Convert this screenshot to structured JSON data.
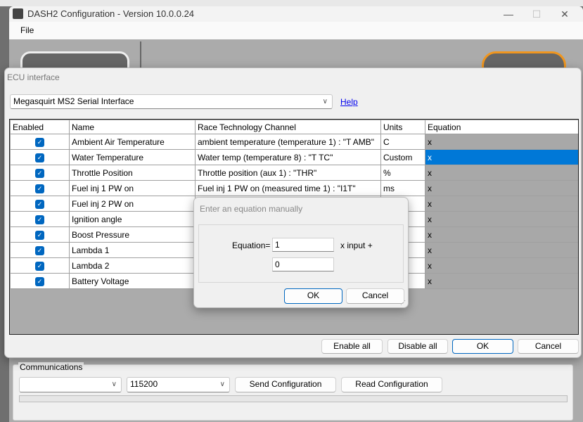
{
  "main_window": {
    "title": "DASH2 Configuration - Version 10.0.0.24",
    "menu": [
      "File"
    ],
    "controls": {
      "minimize": "—",
      "maximize": "☐",
      "close": "✕"
    }
  },
  "ecu_dialog": {
    "title": "ECU interface",
    "interface_select": "Megasquirt MS2 Serial Interface",
    "help_link": "Help",
    "columns": [
      "Enabled",
      "Name",
      "Race Technology Channel",
      "Units",
      "Equation"
    ],
    "rows": [
      {
        "enabled": true,
        "name": "Ambient Air Temperature",
        "channel": "ambient temperature  (temperature 1) : \"T AMB\"",
        "units": "C",
        "equation": "x"
      },
      {
        "enabled": true,
        "name": "Water Temperature",
        "channel": "Water temp  (temperature 8) : \"T TC\"",
        "units": "Custom",
        "equation": "x",
        "selected": true
      },
      {
        "enabled": true,
        "name": "Throttle Position",
        "channel": "Throttle position  (aux 1) : \"THR\"",
        "units": "%",
        "equation": "x"
      },
      {
        "enabled": true,
        "name": "Fuel inj 1 PW on",
        "channel": "Fuel inj 1 PW on  (measured time 1) : \"I1T\"",
        "units": "ms",
        "equation": "x"
      },
      {
        "enabled": true,
        "name": "Fuel inj 2 PW on",
        "channel": "",
        "units": "",
        "equation": "x"
      },
      {
        "enabled": true,
        "name": "Ignition angle",
        "channel": "",
        "units": "",
        "equation": "x"
      },
      {
        "enabled": true,
        "name": "Boost Pressure",
        "channel": "",
        "units": "",
        "equation": "x"
      },
      {
        "enabled": true,
        "name": "Lambda 1",
        "channel": "",
        "units": "",
        "equation": "x"
      },
      {
        "enabled": true,
        "name": "Lambda 2",
        "channel": "",
        "units": "",
        "equation": "x"
      },
      {
        "enabled": true,
        "name": "Battery Voltage",
        "channel": "",
        "units": "",
        "equation": "x"
      }
    ],
    "buttons": {
      "enable_all": "Enable all",
      "disable_all": "Disable all",
      "ok": "OK",
      "cancel": "Cancel"
    }
  },
  "equation_dialog": {
    "title": "Enter an equation manually",
    "label": "Equation=",
    "multiplier": "1",
    "suffix": "x input +",
    "offset": "0",
    "ok": "OK",
    "cancel": "Cancel"
  },
  "communications": {
    "label": "Communications",
    "port": "",
    "baud": "115200",
    "send": "Send Configuration",
    "read": "Read Configuration",
    "progress": 0
  },
  "colors": {
    "accent": "#0067c0",
    "selection": "#0078d7"
  }
}
